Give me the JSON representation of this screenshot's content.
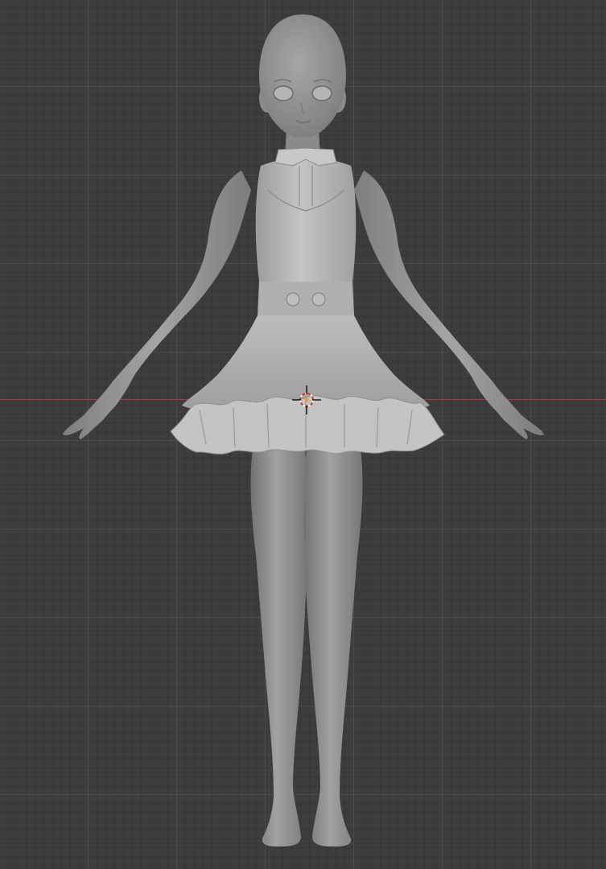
{
  "viewport": {
    "background_color": "#3d3d3d",
    "x_axis_color": "#a8414b",
    "model_color": "#9a9a9a",
    "dress_color": "#b8b8b8"
  },
  "icons": {
    "cursor": "3d-cursor-icon"
  }
}
